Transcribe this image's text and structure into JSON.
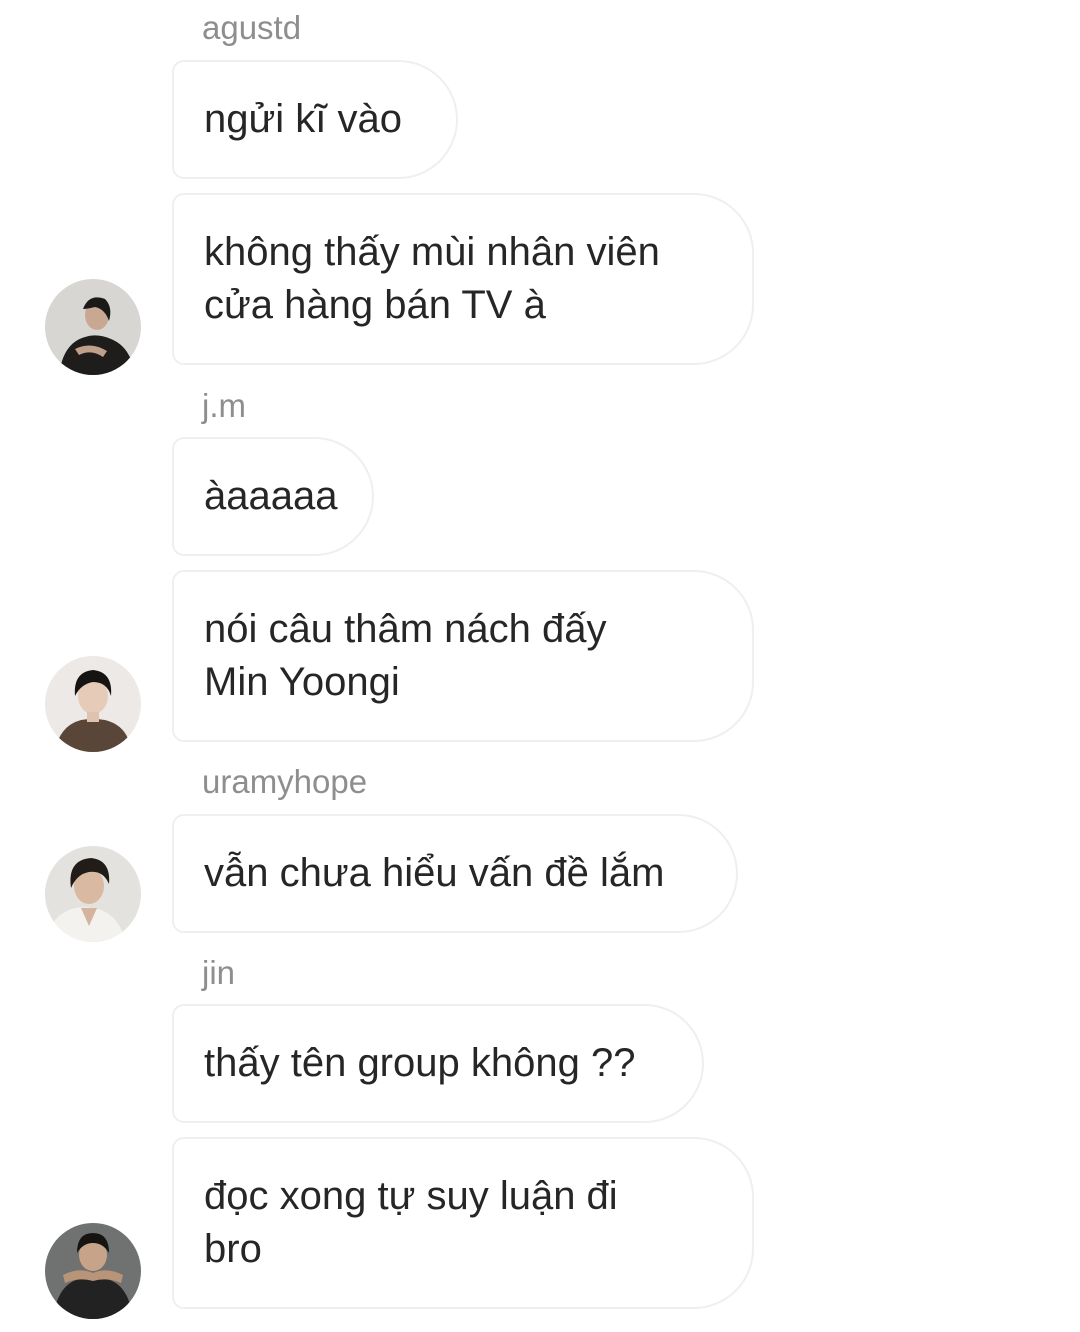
{
  "messages": [
    {
      "sender": "agustd",
      "bubbles": [
        "ngửi kĩ vào",
        "không thấy mùi nhân viên\ncửa hàng bán TV à"
      ]
    },
    {
      "sender": "j.m",
      "bubbles": [
        "àaaaaa",
        "nói câu thâm nách đấy\nMin Yoongi"
      ]
    },
    {
      "sender": "uramyhope",
      "bubbles": [
        "vẫn chưa hiểu vấn đề lắm"
      ]
    },
    {
      "sender": "jin",
      "bubbles": [
        "thấy tên group không ??",
        "đọc xong tự suy luận đi\nbro"
      ]
    }
  ],
  "colors": {
    "sender_text": "#8e8e8e",
    "bubble_border": "#efefef",
    "message_text": "#262626",
    "background": "#ffffff"
  }
}
